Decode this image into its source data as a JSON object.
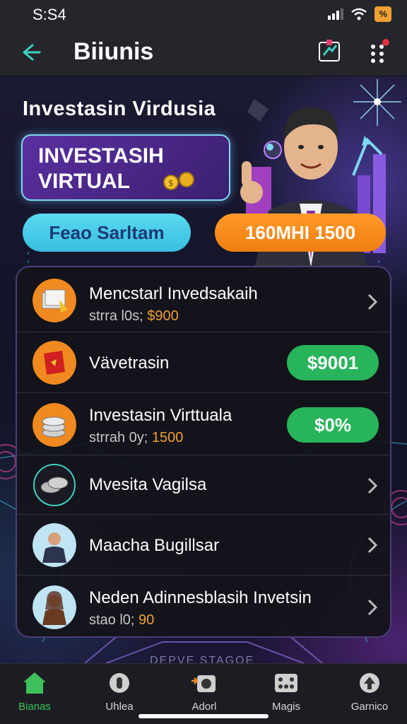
{
  "status_bar": {
    "time": "S:S4",
    "battery": "%"
  },
  "app_bar": {
    "title": "Biiunis"
  },
  "hero": {
    "title": "Investasin Virdusia",
    "card_line1": "INVESTASIH",
    "card_line2": "VIRTUAL",
    "pill_left": "Feao Sarltam",
    "pill_right": "160MHI 1500"
  },
  "list": {
    "items": [
      {
        "title": "Mencstarl Invedsakaih",
        "sub_prefix": "strra l0s; ",
        "sub_amount": "$900",
        "action": "chevron"
      },
      {
        "title": "Vävetrasin",
        "button": "$9001",
        "action": "button"
      },
      {
        "title": "Investasin Virttuala",
        "sub_prefix": "strrah 0y; ",
        "sub_amount": "1500",
        "button": "$0%",
        "action": "button"
      },
      {
        "title": "Mvesita Vagilsa",
        "action": "chevron"
      },
      {
        "title": "Maacha Bugillsar",
        "action": "chevron"
      },
      {
        "title": "Neden Adinnesblasih Invetsin",
        "sub_prefix": "stao l0; ",
        "sub_amount": "90",
        "action": "chevron"
      }
    ]
  },
  "ground_text": "DEPVE STAGOE",
  "bottom_nav": {
    "items": [
      {
        "label": "Bianas",
        "icon": "home-icon",
        "active": true
      },
      {
        "label": "Uhlea",
        "icon": "info-icon",
        "active": false
      },
      {
        "label": "Adorl",
        "icon": "camera-icon",
        "active": false
      },
      {
        "label": "Magis",
        "icon": "dice-icon",
        "active": false
      },
      {
        "label": "Garnico",
        "icon": "upload-icon",
        "active": false
      }
    ]
  },
  "colors": {
    "accent_green": "#28b45a",
    "accent_orange": "#f07e10",
    "accent_cyan": "#38bfe0",
    "amount": "#f0a030"
  }
}
